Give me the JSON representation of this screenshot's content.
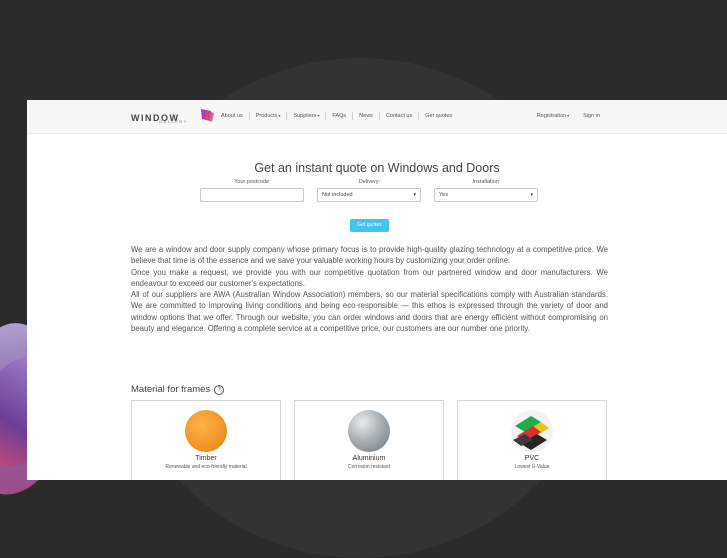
{
  "nav": {
    "logo_text": "WINDOW",
    "logo_sub": "GALLERY",
    "links": [
      "About us",
      "Products",
      "Suppliers",
      "FAQs",
      "News",
      "Contact us",
      "Get quotes"
    ],
    "registration": "Registration",
    "signin": "Sign in",
    "dropdown_caret": "▾"
  },
  "quote": {
    "title": "Get an instant quote on Windows and Doors",
    "postcode_label": "Your postcode:",
    "postcode_value": "",
    "delivery_label": "Delivery:",
    "delivery_value": "Not included",
    "installation_label": "Installation:",
    "installation_value": "Yes",
    "button": "Get quotes"
  },
  "about": {
    "p1": "We are a window and door supply company whose primary focus is to provide high-quality glazing technology at a competitive price. We believe that time is of the essence and we save your valuable working hours by customizing your order online.",
    "p2": "Once you make a request, we provide you with our competitive quotation from our partnered window and door manufacturers. We endeavour to exceed our customer's expectations.",
    "p3": "All of our suppliers are AWA (Australian Window Association) members, so our material specifications comply with Australian standards. We are committed to improving living conditions and being eco-responsible — this ethos is expressed through the variety of door and window options that we offer. Through our website, you can order windows and doors that are energy efficient without compromising on beauty and elegance. Offering a complete service at a competitive price, our customers are our number one priority."
  },
  "materials": {
    "title": "Material for frames",
    "help": "?",
    "cards": [
      {
        "name": "Timber",
        "desc": "Renewable and eco-friendly material",
        "color": "#f39a2b"
      },
      {
        "name": "Aluminium",
        "desc": "Corrosion resistant",
        "color": "#9aa1a8"
      },
      {
        "name": "PVC",
        "desc": "Lowest U-Value",
        "color": "#2b2b2b"
      }
    ]
  },
  "colors": {
    "accent": "#44c3ef",
    "background": "#2b2b2c"
  }
}
